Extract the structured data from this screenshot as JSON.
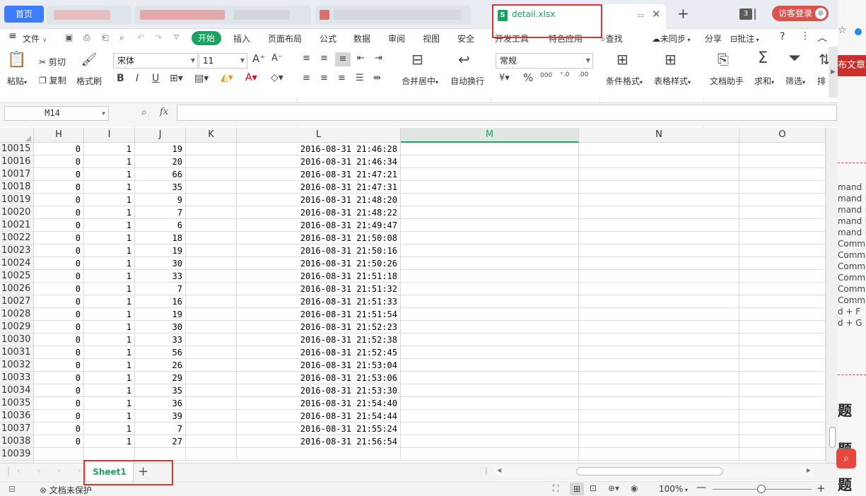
{
  "titlebar": {
    "home_tab": "首页",
    "active_tab": "detail.xlsx",
    "sheet_icon": "S",
    "tab_count": "3",
    "login": "访客登录"
  },
  "menu": {
    "file": "文件",
    "tabs": [
      "开始",
      "插入",
      "页面布局",
      "公式",
      "数据",
      "审阅",
      "视图",
      "安全",
      "开发工具",
      "特色应用"
    ],
    "find": "查找",
    "sync": "未同步",
    "share": "分享",
    "comment": "批注"
  },
  "ribbon": {
    "paste": "粘贴",
    "cut": "剪切",
    "copy": "复制",
    "format_painter": "格式刷",
    "font_name": "宋体",
    "font_size": "11",
    "merge_center": "合并居中",
    "wrap_text": "自动换行",
    "number_format": "常规",
    "conditional_format": "条件格式",
    "table_style": "表格样式",
    "doc_helper": "文档助手",
    "sum": "求和",
    "filter": "筛选",
    "sort": "排序"
  },
  "formula_bar": {
    "name_box": "M14",
    "fx_label": "fx",
    "formula": ""
  },
  "grid": {
    "columns": [
      "H",
      "I",
      "J",
      "K",
      "L",
      "M",
      "N",
      "O"
    ],
    "selected_column": "M",
    "rows": [
      {
        "num": "10015",
        "h": "0",
        "i": "1",
        "j": "19",
        "l": "2016-08-31 21:46:28"
      },
      {
        "num": "10016",
        "h": "0",
        "i": "1",
        "j": "20",
        "l": "2016-08-31 21:46:34"
      },
      {
        "num": "10017",
        "h": "0",
        "i": "1",
        "j": "66",
        "l": "2016-08-31 21:47:21"
      },
      {
        "num": "10018",
        "h": "0",
        "i": "1",
        "j": "35",
        "l": "2016-08-31 21:47:31"
      },
      {
        "num": "10019",
        "h": "0",
        "i": "1",
        "j": "9",
        "l": "2016-08-31 21:48:20"
      },
      {
        "num": "10020",
        "h": "0",
        "i": "1",
        "j": "7",
        "l": "2016-08-31 21:48:22"
      },
      {
        "num": "10021",
        "h": "0",
        "i": "1",
        "j": "6",
        "l": "2016-08-31 21:49:47"
      },
      {
        "num": "10022",
        "h": "0",
        "i": "1",
        "j": "18",
        "l": "2016-08-31 21:50:08"
      },
      {
        "num": "10023",
        "h": "0",
        "i": "1",
        "j": "19",
        "l": "2016-08-31 21:50:16"
      },
      {
        "num": "10024",
        "h": "0",
        "i": "1",
        "j": "30",
        "l": "2016-08-31 21:50:26"
      },
      {
        "num": "10025",
        "h": "0",
        "i": "1",
        "j": "33",
        "l": "2016-08-31 21:51:18"
      },
      {
        "num": "10026",
        "h": "0",
        "i": "1",
        "j": "7",
        "l": "2016-08-31 21:51:32"
      },
      {
        "num": "10027",
        "h": "0",
        "i": "1",
        "j": "16",
        "l": "2016-08-31 21:51:33"
      },
      {
        "num": "10028",
        "h": "0",
        "i": "1",
        "j": "19",
        "l": "2016-08-31 21:51:54"
      },
      {
        "num": "10029",
        "h": "0",
        "i": "1",
        "j": "30",
        "l": "2016-08-31 21:52:23"
      },
      {
        "num": "10030",
        "h": "0",
        "i": "1",
        "j": "33",
        "l": "2016-08-31 21:52:38"
      },
      {
        "num": "10031",
        "h": "0",
        "i": "1",
        "j": "56",
        "l": "2016-08-31 21:52:45"
      },
      {
        "num": "10032",
        "h": "0",
        "i": "1",
        "j": "26",
        "l": "2016-08-31 21:53:04"
      },
      {
        "num": "10033",
        "h": "0",
        "i": "1",
        "j": "29",
        "l": "2016-08-31 21:53:06"
      },
      {
        "num": "10034",
        "h": "0",
        "i": "1",
        "j": "35",
        "l": "2016-08-31 21:53:30"
      },
      {
        "num": "10035",
        "h": "0",
        "i": "1",
        "j": "36",
        "l": "2016-08-31 21:54:40"
      },
      {
        "num": "10036",
        "h": "0",
        "i": "1",
        "j": "39",
        "l": "2016-08-31 21:54:44"
      },
      {
        "num": "10037",
        "h": "0",
        "i": "1",
        "j": "7",
        "l": "2016-08-31 21:55:24"
      },
      {
        "num": "10038",
        "h": "0",
        "i": "1",
        "j": "27",
        "l": "2016-08-31 21:56:54"
      },
      {
        "num": "10039",
        "h": "",
        "i": "",
        "j": "",
        "l": ""
      }
    ]
  },
  "sheets": {
    "active": "Sheet1",
    "add": "+"
  },
  "status": {
    "protect": "文档未保护",
    "zoom": "100%",
    "zoom_percent_value": 100
  },
  "side_panel": {
    "publish": "布文章",
    "lines": [
      "mand +",
      "mand +",
      "mand +",
      "mand +",
      "mand +",
      "Comma",
      "Comma",
      "Comma",
      "Comma",
      "Comma",
      "Comma",
      "d + F",
      "d + G"
    ],
    "headings": [
      "题",
      "题",
      "题"
    ]
  },
  "colors": {
    "accent_green": "#1aa260",
    "highlight_red": "#e0312e",
    "home_blue": "#3d7cff"
  }
}
